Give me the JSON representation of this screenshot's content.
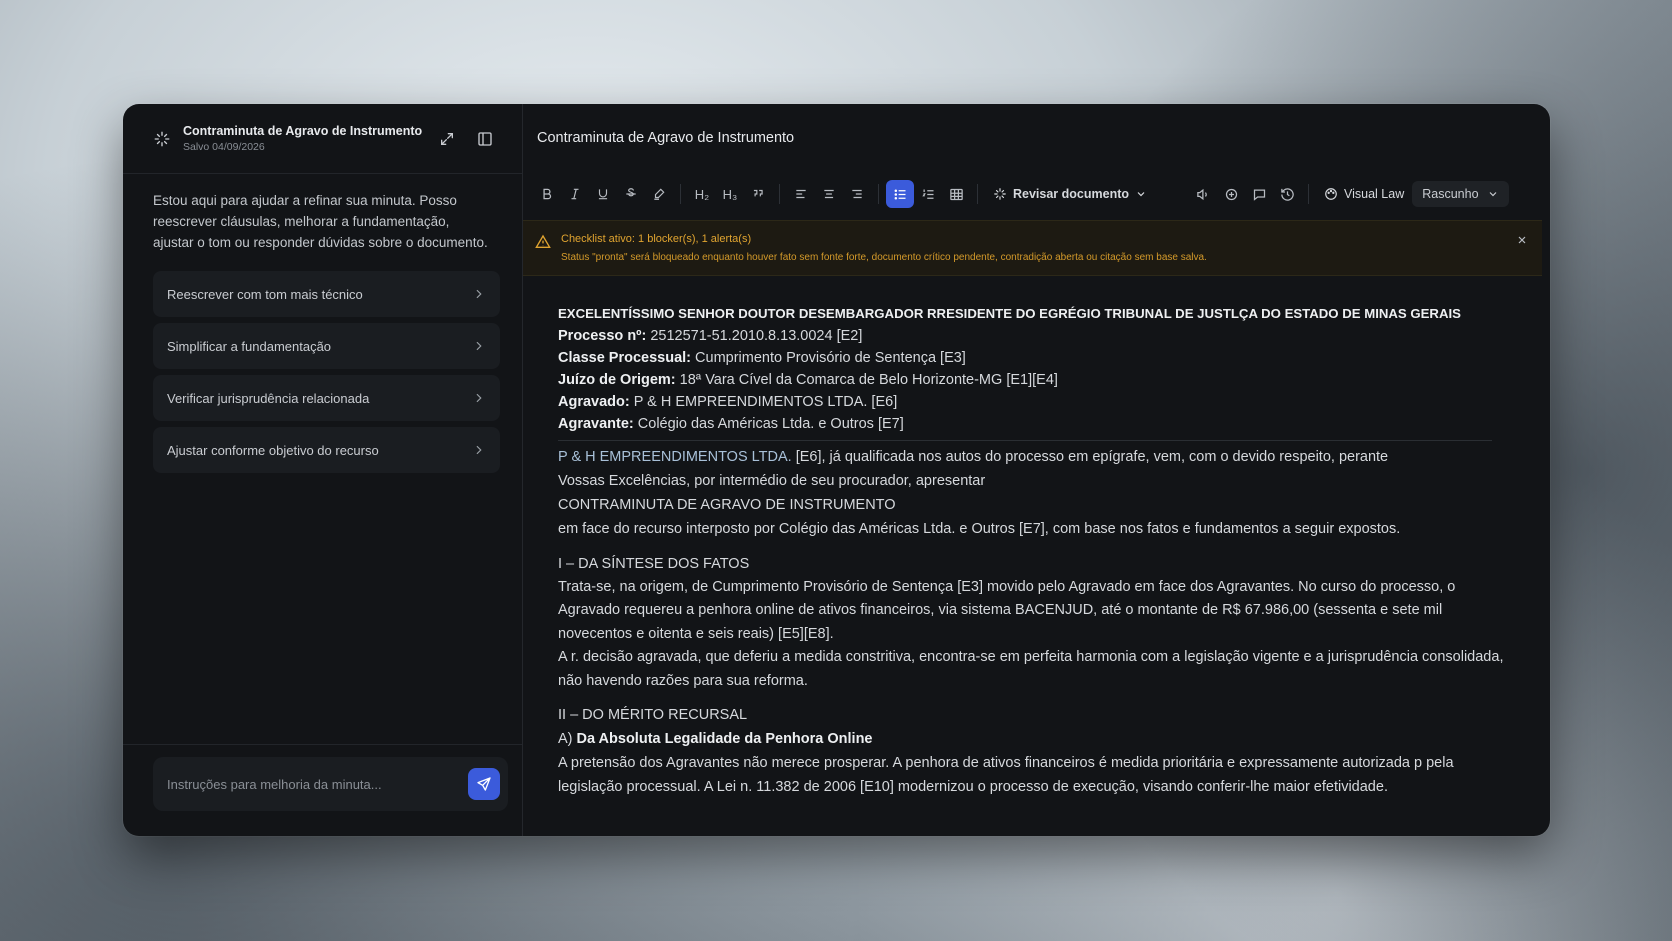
{
  "sidebar": {
    "title": "Contraminuta de Agravo de Instrumento",
    "saved": "Salvo 04/09/2026",
    "intro": "Estou aqui para ajudar a refinar sua minuta. Posso reescrever cláusulas, melhorar a fundamentação, ajustar o tom ou responder dúvidas sobre o documento.",
    "suggestions": [
      "Reescrever com tom mais técnico",
      "Simplificar a fundamentação",
      "Verificar jurisprudência relacionada",
      "Ajustar conforme objetivo do recurso"
    ],
    "input_placeholder": "Instruções para melhoria da minuta..."
  },
  "editor": {
    "title": "Contraminuta de Agravo de Instrumento",
    "toolbar": {
      "h2": "H₂",
      "h3": "H₃",
      "review_label": "Revisar documento",
      "visual_law_label": "Visual Law",
      "status_value": "Rascunho"
    },
    "alert": {
      "title": "Checklist ativo: 1 blocker(s), 1 alerta(s)",
      "message": "Status \"pronta\" será bloqueado enquanto houver fato sem fonte forte, documento crítico pendente, contradição aberta ou citação sem base salva."
    },
    "document": {
      "addressee": "EXCELENTÍSSIMO SENHOR DOUTOR DESEMBARGADOR RRESIDENTE DO EGRÉGIO TRIBUNAL DE JUSTLÇA DO ESTADO DE MINAS GERAIS",
      "fields": [
        {
          "label": "Processo nº:",
          "value": " 2512571-51.2010.8.13.0024 [E2]"
        },
        {
          "label": "Classe Processual:",
          "value": " Cumprimento Provisório de Sentença [E3]"
        },
        {
          "label": "Juízo de Origem:",
          "value": " 18ª Vara Cível da Comarca de Belo Horizonte-MG [E1][E4]"
        },
        {
          "label": "Agravado:",
          "value": " P & H EMPREENDIMENTOS LTDA. [E6]"
        },
        {
          "label": "Agravante:",
          "value": " Colégio das Américas Ltda. e Outros [E7]"
        }
      ],
      "intro_party": "P & H EMPREENDIMENTOS LTDA.",
      "intro_rest": " [E6], já qualificada nos autos do processo em epígrafe, vem, com o devido respeito, perante",
      "intro_line2": "Vossas Excelências, por intermédio de seu procurador, apresentar",
      "doc_type": "CONTRAMINUTA DE AGRAVO DE INSTRUMENTO",
      "intro_line3": "em face do recurso interposto por Colégio das Américas Ltda. e Outros [E7], com base nos fatos e fundamentos a seguir expostos.",
      "section1_title": "I – DA SÍNTESE DOS FATOS",
      "section1_p1": "Trata-se, na origem, de Cumprimento Provisório de Sentença [E3] movido pelo Agravado em face dos Agravantes. No curso do processo, o Agravado requereu a penhora online de ativos financeiros, via sistema BACENJUD, até o montante de R$ 67.986,00 (sessenta e sete mil novecentos e oitenta e seis reais) [E5][E8].",
      "section1_p2": "A r. decisão agravada, que deferiu a medida constritiva, encontra-se em perfeita harmonia com a legislação vigente e a jurisprudência consolidada, não havendo razões para sua reforma.",
      "section2_title": "II – DO MÉRITO RECURSAL",
      "section2_sub_prefix": "A) ",
      "section2_sub_title": "Da Absoluta Legalidade da Penhora Online",
      "section2_p1": "A pretensão dos Agravantes não merece prosperar. A penhora de ativos financeiros é medida prioritária e expressamente autorizada p pela legislação processual. A Lei n. 11.382 de 2006 [E10] modernizou o processo de execução, visando conferir-lhe maior efetividade."
    }
  }
}
